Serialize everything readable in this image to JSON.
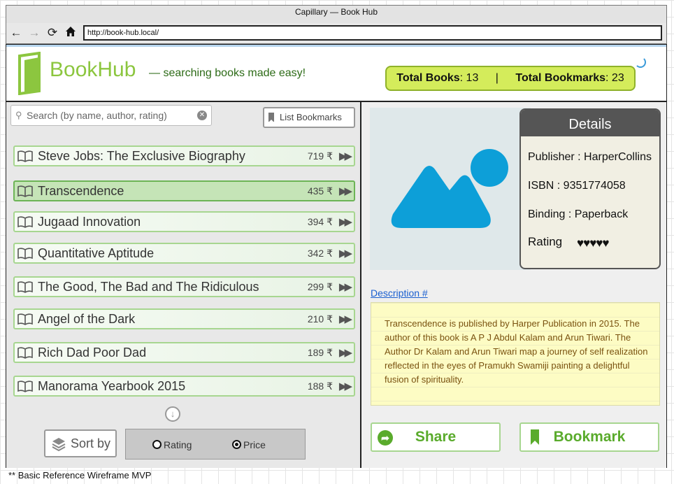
{
  "window": {
    "title": "Capillary — Book Hub"
  },
  "browser": {
    "url": "http://book-hub.local/",
    "back_icon": "arrow-left-icon",
    "forward_icon": "arrow-right-icon",
    "reload_icon": "reload-icon",
    "home_icon": "home-icon"
  },
  "header": {
    "logo_text": "BookHub",
    "tagline": "— searching books made easy!",
    "total_books_label": "Total Books",
    "total_books_value": ": 13",
    "separator": "|",
    "total_bookmarks_label": "Total Bookmarks",
    "total_bookmarks_value": ": 23",
    "accent_color": "#8cc63f"
  },
  "search": {
    "placeholder": "Search (by name, author, rating)",
    "value": ""
  },
  "list_bookmarks_label": "List Bookmarks",
  "books": [
    {
      "title": "Steve Jobs: The Exclusive Biography",
      "price": "719 ₹"
    },
    {
      "title": "Transcendence",
      "price": "435 ₹",
      "selected": true
    },
    {
      "title": "Jugaad Innovation",
      "price": "394 ₹"
    },
    {
      "title": "Quantitative Aptitude",
      "price": "342 ₹"
    },
    {
      "title": "The Good, The Bad and The Ridiculous",
      "price": "299 ₹"
    },
    {
      "title": "Angel of the Dark",
      "price": "210 ₹"
    },
    {
      "title": "Rich Dad Poor Dad",
      "price": "189 ₹"
    },
    {
      "title": "Manorama Yearbook 2015",
      "price": "188 ₹"
    }
  ],
  "sort": {
    "button_label": "Sort by",
    "options": [
      {
        "label": "Rating",
        "selected": false
      },
      {
        "label": "Price",
        "selected": true
      }
    ]
  },
  "details": {
    "heading": "Details",
    "publisher": "Publisher : HarperCollins",
    "isbn": "ISBN : 9351774058",
    "binding": "Binding : Paperback",
    "rating_label": "Rating",
    "rating_hearts": "♥♥♥♥♥",
    "rating_value": 5
  },
  "description": {
    "link_label": "Description #",
    "text": "Transcendence is published by Harper Publication in 2015. The author of this book is A P J Abdul Kalam and Arun Tiwari. The Author Dr Kalam and Arun Tiwari map a journey of self realization reflected in the eyes of Pramukh Swamiji painting a delightful fusion of spirituality."
  },
  "actions": {
    "share_label": "Share",
    "bookmark_label": "Bookmark"
  },
  "footer": {
    "note": "** Basic Reference Wireframe MVP"
  }
}
